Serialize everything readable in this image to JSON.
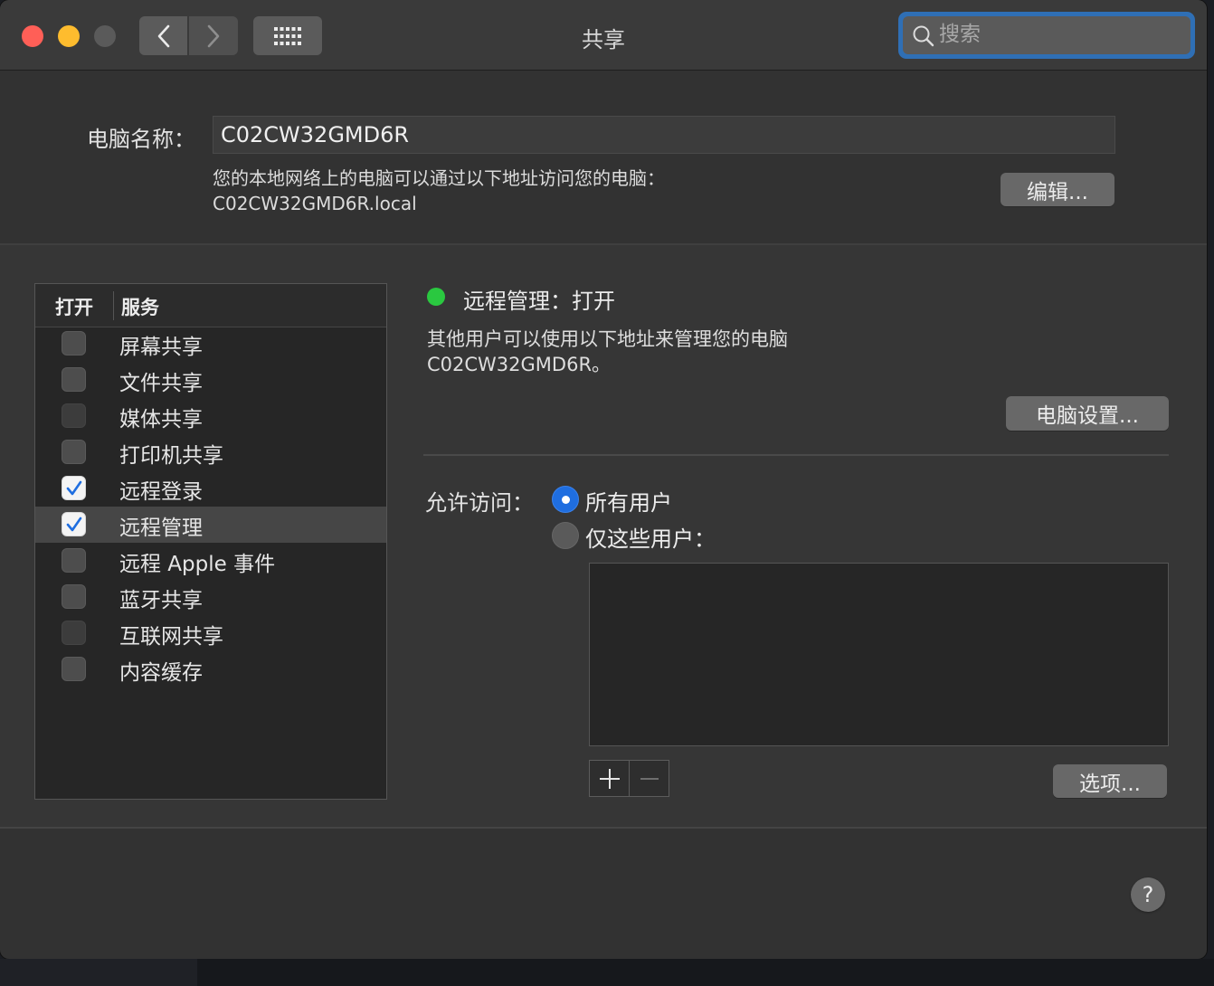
{
  "window": {
    "title": "共享"
  },
  "search": {
    "placeholder": "搜索"
  },
  "computer_name": {
    "label": "电脑名称：",
    "value": "C02CW32GMD6R",
    "description_line1": "您的本地网络上的电脑可以通过以下地址访问您的电脑：",
    "description_line2": "C02CW32GMD6R.local",
    "edit_button": "编辑..."
  },
  "services": {
    "header_on": "打开",
    "header_service": "服务",
    "items": [
      {
        "label": "屏幕共享",
        "checked": false,
        "dim": false
      },
      {
        "label": "文件共享",
        "checked": false,
        "dim": false
      },
      {
        "label": "媒体共享",
        "checked": false,
        "dim": true
      },
      {
        "label": "打印机共享",
        "checked": false,
        "dim": false
      },
      {
        "label": "远程登录",
        "checked": true,
        "dim": false
      },
      {
        "label": "远程管理",
        "checked": true,
        "dim": false,
        "selected": true
      },
      {
        "label": "远程 Apple 事件",
        "checked": false,
        "dim": false
      },
      {
        "label": "蓝牙共享",
        "checked": false,
        "dim": false
      },
      {
        "label": "互联网共享",
        "checked": false,
        "dim": true
      },
      {
        "label": "内容缓存",
        "checked": false,
        "dim": false
      }
    ]
  },
  "detail": {
    "status": "远程管理：打开",
    "status_color": "#2ac840",
    "description_line1": "其他用户可以使用以下地址来管理您的电脑",
    "description_line2": "C02CW32GMD6R。",
    "computer_settings_button": "电脑设置...",
    "access_label": "允许访问：",
    "option_all_users": "所有用户",
    "option_only_these_users": "仅这些用户：",
    "selected_option": "所有用户",
    "options_button": "选项...",
    "add_symbol": "+",
    "remove_symbol": "−"
  },
  "help": {
    "symbol": "?"
  },
  "colors": {
    "accent": "#1f6ee0",
    "close": "#ff5f57",
    "minimize": "#febc2e"
  }
}
